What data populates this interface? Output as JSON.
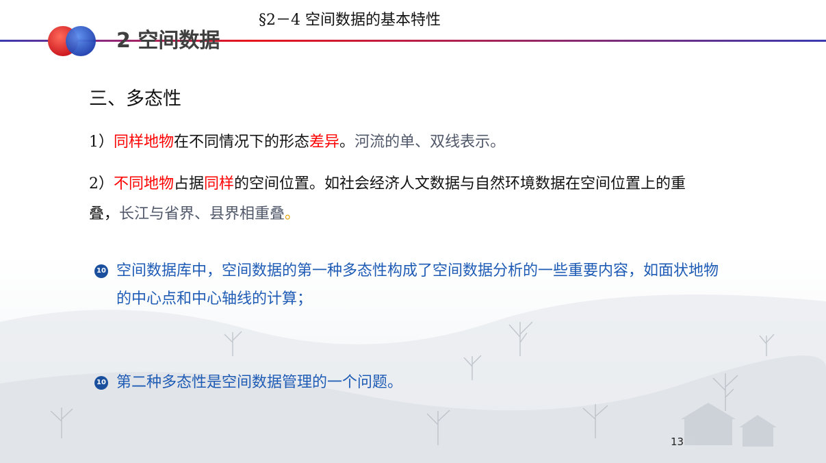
{
  "header": {
    "section_title": "2 空间数据",
    "topic_prefix": "§2－4",
    "topic": "空间数据的基本特性"
  },
  "heading": "三、多态性",
  "paragraphs": [
    {
      "num": "1）",
      "parts": [
        {
          "text": "同样地物",
          "style": "red"
        },
        {
          "text": "在不同情况下的形态",
          "style": "normal"
        },
        {
          "text": "差异",
          "style": "red"
        },
        {
          "text": "。",
          "style": "normal"
        },
        {
          "text": "河流的单、双线表示。",
          "style": "gray"
        }
      ]
    },
    {
      "num": "2）",
      "parts": [
        {
          "text": "不同地物",
          "style": "red"
        },
        {
          "text": "占据",
          "style": "normal"
        },
        {
          "text": "同样",
          "style": "red"
        },
        {
          "text": "的空间位置。如社会经济人文数据与自然环境数据在空间位置上的重叠，",
          "style": "normal"
        },
        {
          "text": "长江与省界、县界相重叠",
          "style": "gray"
        },
        {
          "text": "。",
          "style": "gold"
        }
      ]
    }
  ],
  "bullets": [
    {
      "mark": "10",
      "text": "空间数据库中，空间数据的第一种多态性构成了空间数据分析的一些重要内容，如面状地物的中心点和中心轴线的计算；"
    },
    {
      "mark": "10",
      "text": "第二种多态性是空间数据管理的一个问题。"
    }
  ],
  "page_number": "13",
  "colors": {
    "emphasis_red": "#ff0000",
    "example_gray": "#50586a",
    "bullet_blue": "#1e5bb5",
    "header_line_red": "#e8151c",
    "header_line_blue": "#3a3ab0"
  }
}
